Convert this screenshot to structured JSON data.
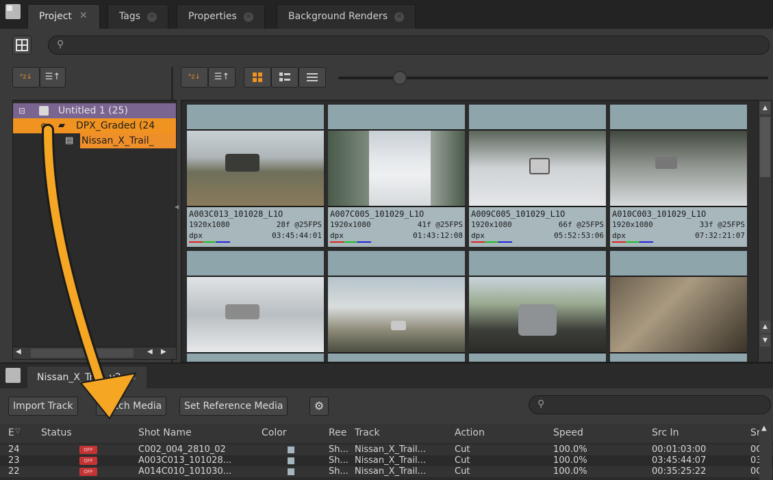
{
  "tabs": [
    {
      "label": "Project",
      "active": true
    },
    {
      "label": "Tags",
      "active": false
    },
    {
      "label": "Properties",
      "active": false
    },
    {
      "label": "Background Renders",
      "active": false
    }
  ],
  "tree": {
    "root": "Untitled 1 (25)",
    "bin": "DPX_Graded (24",
    "sequence": "Nissan_X_Trail_"
  },
  "clips": [
    {
      "name": "A003C013_101028_L1O",
      "res": "1920x1080",
      "frames": "28f @25FPS",
      "fmt": "dpx",
      "tc": "03:45:44:01"
    },
    {
      "name": "A007C005_101029_L1O",
      "res": "1920x1080",
      "frames": "41f @25FPS",
      "fmt": "dpx",
      "tc": "01:43:12:08"
    },
    {
      "name": "A009C005_101029_L1O",
      "res": "1920x1080",
      "frames": "66f @25FPS",
      "fmt": "dpx",
      "tc": "05:52:53:06"
    },
    {
      "name": "A010C003_101029_L1O",
      "res": "1920x1080",
      "frames": "33f @25FPS",
      "fmt": "dpx",
      "tc": "07:32:21:07"
    }
  ],
  "timeline": {
    "tab_label": "Nissan_X_Trail_v2",
    "buttons": {
      "import": "Import Track",
      "match": "Match Media",
      "reference": "Set Reference Media"
    },
    "columns": {
      "e": "E",
      "status": "Status",
      "shot": "Shot Name",
      "color": "Color",
      "reel": "Ree",
      "track": "Track",
      "action": "Action",
      "speed": "Speed",
      "srcin": "Src In",
      "srcout": "Sr"
    },
    "rows": [
      {
        "e": "24",
        "status": "OFF",
        "shot": "C002_004_2810_02",
        "reel": "Sh...",
        "track": "Nissan_X_Trail...",
        "action": "Cut",
        "speed": "100.0%",
        "srcin": "00:01:03:00",
        "srcout": "0C"
      },
      {
        "e": "23",
        "status": "OFF",
        "shot": "A003C013_101028...",
        "reel": "Sh...",
        "track": "Nissan_X_Trail...",
        "action": "Cut",
        "speed": "100.0%",
        "srcin": "03:45:44:07",
        "srcout": "03"
      },
      {
        "e": "22",
        "status": "OFF",
        "shot": "A014C010_101030...",
        "reel": "Sh...",
        "track": "Nissan_X_Trail...",
        "action": "Cut",
        "speed": "100.0%",
        "srcin": "00:35:25:22",
        "srcout": "0C"
      }
    ]
  },
  "colors": {
    "accent": "#f19321",
    "purple": "#7a6490",
    "off": "#c43434",
    "arrow": "#f5a623"
  }
}
